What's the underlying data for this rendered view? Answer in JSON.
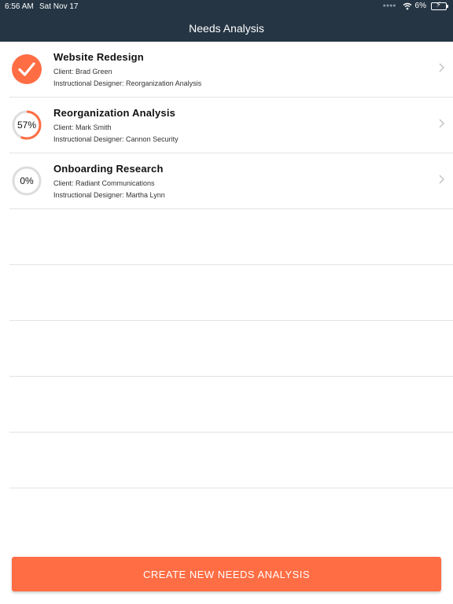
{
  "status_bar": {
    "time": "6:56 AM",
    "date": "Sat Nov 17",
    "battery_percent": "6%",
    "icons": [
      "signal-dots-icon",
      "wifi-icon",
      "battery-charging-icon"
    ]
  },
  "navbar": {
    "title": "Needs Analysis"
  },
  "projects": [
    {
      "title": "Website Redesign",
      "client": "Client: Brad Green",
      "designer": "Instructional Designer: Reorganization Analysis",
      "progress": 1.0,
      "status": "complete"
    },
    {
      "title": "Reorganization Analysis",
      "client": "Client: Mark Smith",
      "designer": "Instructional Designer: Cannon Security",
      "progress": 0.57,
      "progress_label": "57%"
    },
    {
      "title": "Onboarding Research",
      "client": "Client: Radiant Communications",
      "designer": "Instructional Designer: Martha Lynn",
      "progress": 0.0,
      "progress_label": "0%"
    }
  ],
  "create_button": {
    "label": "CREATE NEW NEEDS ANALYSIS"
  },
  "colors": {
    "header_bg": "#253544",
    "accent": "#ff6d44",
    "ring_track": "#dddddd",
    "divider": "#e3e3e3"
  }
}
